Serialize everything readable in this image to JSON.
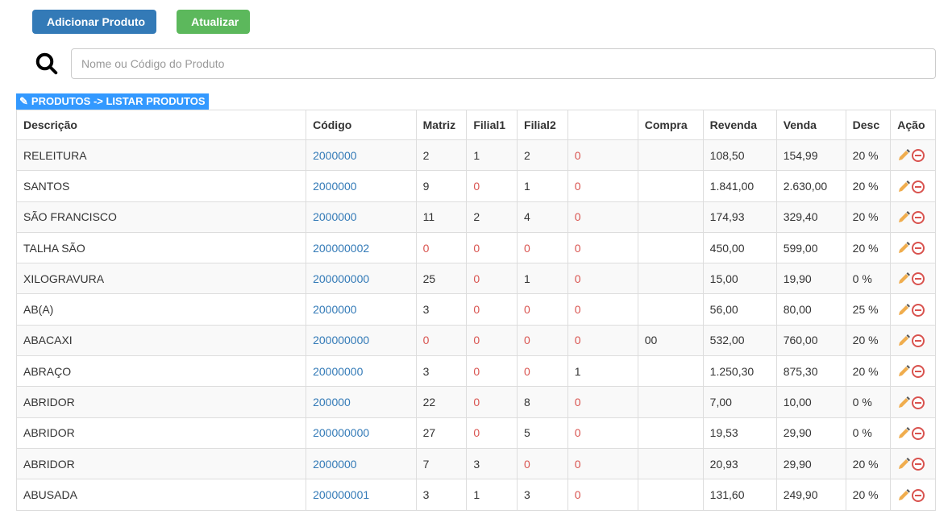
{
  "toolbar": {
    "add_label": "Adicionar Produto",
    "refresh_label": "Atualizar"
  },
  "search": {
    "placeholder": "Nome ou Código do Produto"
  },
  "breadcrumb": {
    "text": "PRODUTOS -> LISTAR PRODUTOS"
  },
  "table": {
    "headers": {
      "descricao": "Descrição",
      "codigo": "Código",
      "matriz": "Matriz",
      "filial1": "Filial1",
      "filial2": "Filial2",
      "blank": "",
      "compra": "Compra",
      "revenda": "Revenda",
      "venda": "Venda",
      "desc": "Desc",
      "acao": "Ação"
    },
    "rows": [
      {
        "descricao": "RELEITURA",
        "codigo": "2000000",
        "matriz": "2",
        "filial1": "1",
        "filial2": "2",
        "blank": "0",
        "compra": "",
        "revenda": "108,50",
        "venda": "154,99",
        "desc": "20 %"
      },
      {
        "descricao": "SANTOS",
        "codigo": "2000000",
        "matriz": "9",
        "filial1": "0",
        "filial2": "1",
        "blank": "0",
        "compra": "",
        "revenda": "1.841,00",
        "venda": "2.630,00",
        "desc": "20 %"
      },
      {
        "descricao": "SÃO FRANCISCO",
        "codigo": "2000000",
        "matriz": "11",
        "filial1": "2",
        "filial2": "4",
        "blank": "0",
        "compra": "",
        "revenda": "174,93",
        "venda": "329,40",
        "desc": "20 %"
      },
      {
        "descricao": "TALHA SÃO",
        "codigo": "200000002",
        "matriz": "0",
        "filial1": "0",
        "filial2": "0",
        "blank": "0",
        "compra": "",
        "revenda": "450,00",
        "venda": "599,00",
        "desc": "20 %"
      },
      {
        "descricao": "XILOGRAVURA",
        "codigo": "200000000",
        "matriz": "25",
        "filial1": "0",
        "filial2": "1",
        "blank": "0",
        "compra": "",
        "revenda": "15,00",
        "venda": "19,90",
        "desc": "0 %"
      },
      {
        "descricao": "AB(A)",
        "codigo": "2000000",
        "matriz": "3",
        "filial1": "0",
        "filial2": "0",
        "blank": "0",
        "compra": "",
        "revenda": "56,00",
        "venda": "80,00",
        "desc": "25 %"
      },
      {
        "descricao": "ABACAXI",
        "codigo": "200000000",
        "matriz": "0",
        "filial1": "0",
        "filial2": "0",
        "blank": "0",
        "compra": "00",
        "revenda": "532,00",
        "venda": "760,00",
        "desc": "20 %"
      },
      {
        "descricao": "ABRAÇO",
        "codigo": "20000000",
        "matriz": "3",
        "filial1": "0",
        "filial2": "0",
        "blank": "1",
        "compra": "",
        "revenda": "1.250,30",
        "venda": "875,30",
        "desc": "20 %"
      },
      {
        "descricao": "ABRIDOR",
        "codigo": "200000",
        "matriz": "22",
        "filial1": "0",
        "filial2": "8",
        "blank": "0",
        "compra": "",
        "revenda": "7,00",
        "venda": "10,00",
        "desc": "0 %"
      },
      {
        "descricao": "ABRIDOR",
        "codigo": "200000000",
        "matriz": "27",
        "filial1": "0",
        "filial2": "5",
        "blank": "0",
        "compra": "",
        "revenda": "19,53",
        "venda": "29,90",
        "desc": "0 %"
      },
      {
        "descricao": "ABRIDOR",
        "codigo": "2000000",
        "matriz": "7",
        "filial1": "3",
        "filial2": "0",
        "blank": "0",
        "compra": "",
        "revenda": "20,93",
        "venda": "29,90",
        "desc": "20 %"
      },
      {
        "descricao": "ABUSADA",
        "codigo": "200000001",
        "matriz": "3",
        "filial1": "1",
        "filial2": "3",
        "blank": "0",
        "compra": "",
        "revenda": "131,60",
        "venda": "249,90",
        "desc": "20 %"
      }
    ]
  }
}
